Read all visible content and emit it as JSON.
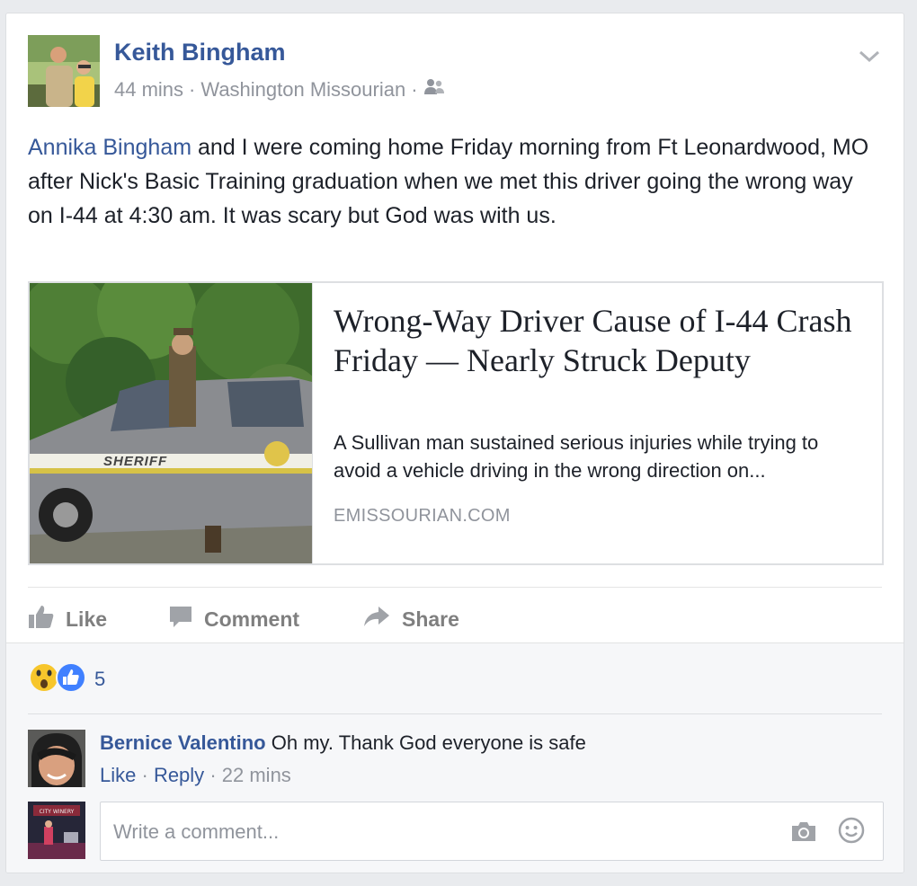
{
  "post": {
    "author": "Keith Bingham",
    "time": "44 mins",
    "separator": "·",
    "source": "Washington Missourian",
    "audience_icon": "friends-icon",
    "mention": "Annika Bingham",
    "text": " and I were coming home Friday morning from Ft Leonardwood, MO after Nick's Basic Training graduation when we met this driver going the wrong way on I-44 at 4:30 am. It was scary but God was with us."
  },
  "link": {
    "title": "Wrong-Way Driver Cause of I-44 Crash Friday — Nearly Struck Deputy",
    "description": "A Sullivan man sustained serious injuries while trying to avoid a vehicle driving in the wrong direction on...",
    "domain": "EMISSOURIAN.COM",
    "image_text": "SHERIFF"
  },
  "actions": {
    "like": "Like",
    "comment": "Comment",
    "share": "Share"
  },
  "reactions": {
    "count": "5",
    "icons": [
      "wow-icon",
      "like-icon"
    ]
  },
  "comment": {
    "author": "Bernice Valentino",
    "text": "Oh my. Thank God everyone is safe",
    "like": "Like",
    "reply": "Reply",
    "dot": "·",
    "time": "22 mins"
  },
  "writer": {
    "placeholder": "Write a comment...",
    "avatar_sign": "CITY WINERY"
  },
  "colors": {
    "link_blue": "#365899",
    "like_blue": "#4080ff",
    "muted": "#90949c",
    "background": "#e9ebee"
  }
}
